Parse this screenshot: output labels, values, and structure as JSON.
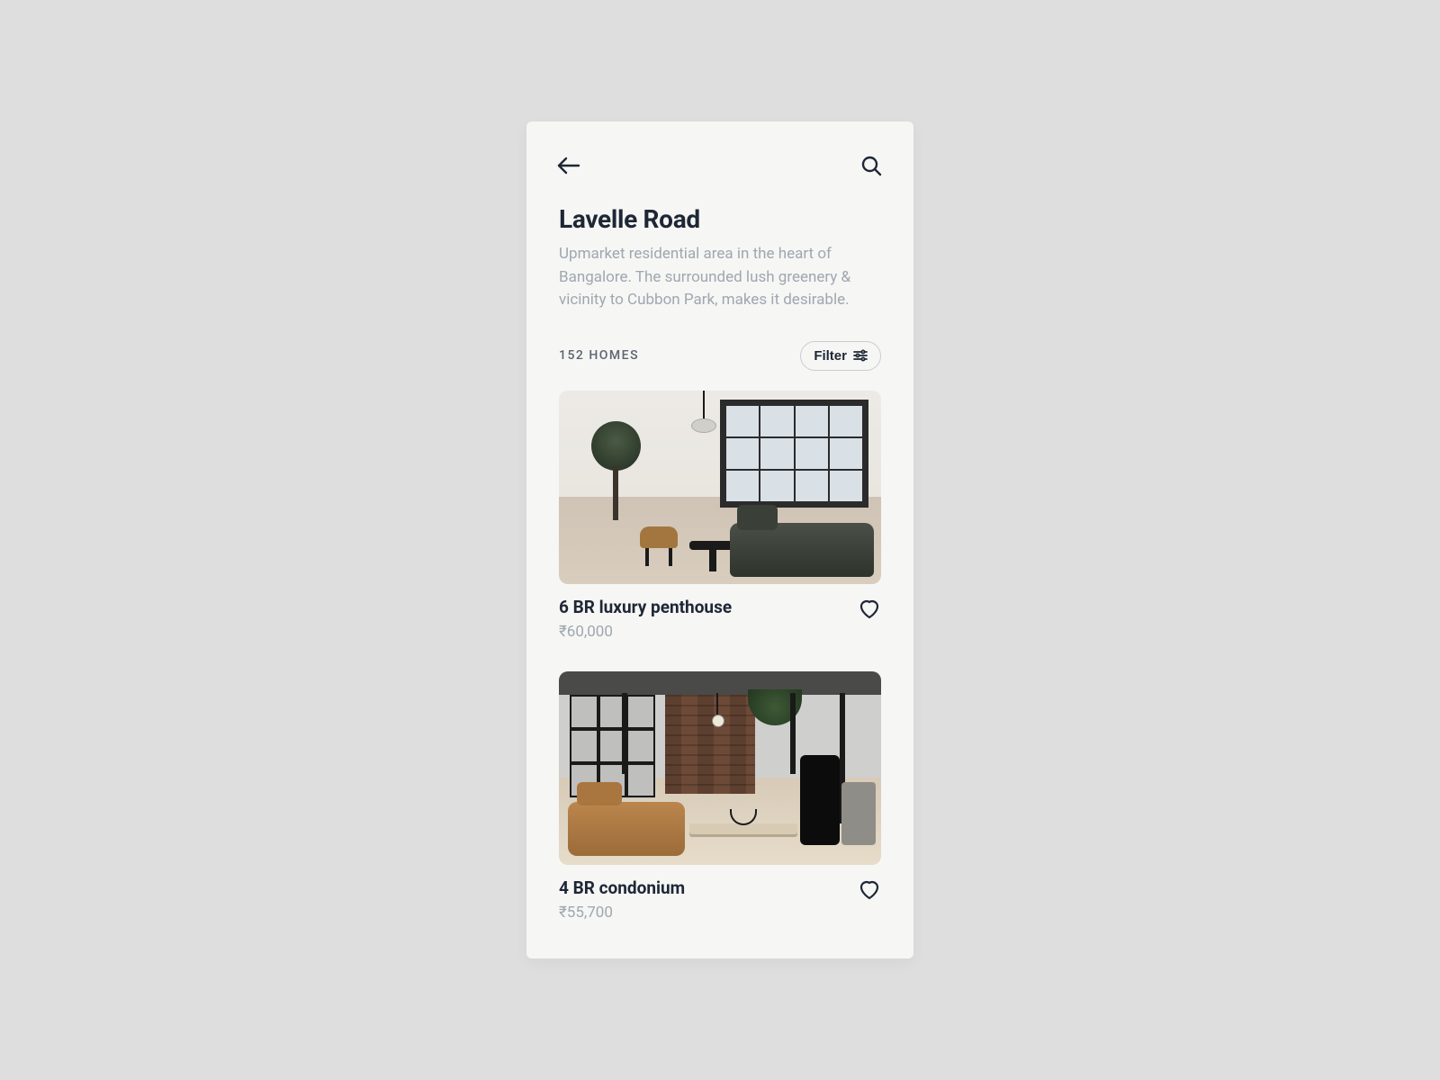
{
  "header": {
    "title": "Lavelle Road",
    "subtitle": "Upmarket residential area in the heart of Bangalore. The surrounded lush greenery & vicinity to Cubbon Park, makes it desirable."
  },
  "meta": {
    "count_label": "152 HOMES",
    "filter_label": "Filter"
  },
  "listings": [
    {
      "title": "6 BR luxury penthouse",
      "price": "₹60,000"
    },
    {
      "title": "4 BR condonium",
      "price": "₹55,700"
    }
  ]
}
